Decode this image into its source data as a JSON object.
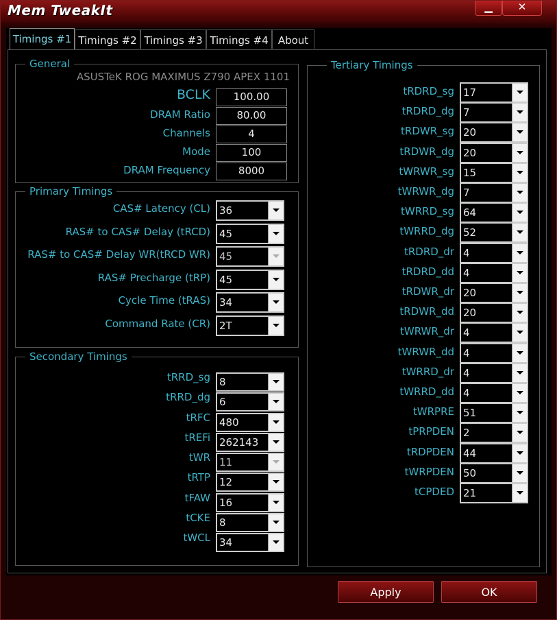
{
  "window": {
    "title": "Mem TweakIt",
    "minimize_glyph": "▁",
    "close_glyph": "✕"
  },
  "tabs": [
    {
      "label": "Timings #1",
      "active": true
    },
    {
      "label": "Timings #2",
      "active": false
    },
    {
      "label": "Timings #3",
      "active": false
    },
    {
      "label": "Timings #4",
      "active": false
    },
    {
      "label": "About",
      "active": false
    }
  ],
  "general": {
    "title": "General",
    "board": "ASUSTeK ROG MAXIMUS Z790 APEX 1101",
    "fields": [
      {
        "label": "BCLK",
        "value": "100.00"
      },
      {
        "label": "DRAM Ratio",
        "value": "80.00"
      },
      {
        "label": "Channels",
        "value": "4"
      },
      {
        "label": "Mode",
        "value": "100"
      },
      {
        "label": "DRAM Frequency",
        "value": "8000"
      }
    ]
  },
  "primary": {
    "title": "Primary Timings",
    "rows": [
      {
        "label": "CAS# Latency (CL)",
        "value": "36",
        "enabled": true
      },
      {
        "label": "RAS# to CAS# Delay (tRCD)",
        "value": "45",
        "enabled": true
      },
      {
        "label": "RAS# to CAS# Delay WR(tRCD WR)",
        "value": "45",
        "enabled": false
      },
      {
        "label": "RAS# Precharge (tRP)",
        "value": "45",
        "enabled": true
      },
      {
        "label": "Cycle Time (tRAS)",
        "value": "34",
        "enabled": true
      },
      {
        "label": "Command Rate (CR)",
        "value": "2T",
        "enabled": true
      }
    ]
  },
  "secondary": {
    "title": "Secondary Timings",
    "rows": [
      {
        "label": "tRRD_sg",
        "value": "8",
        "enabled": true
      },
      {
        "label": "tRRD_dg",
        "value": "6",
        "enabled": true
      },
      {
        "label": "tRFC",
        "value": "480",
        "enabled": true
      },
      {
        "label": "tREFi",
        "value": "262143",
        "enabled": true
      },
      {
        "label": "tWR",
        "value": "11",
        "enabled": false
      },
      {
        "label": "tRTP",
        "value": "12",
        "enabled": true
      },
      {
        "label": "tFAW",
        "value": "16",
        "enabled": true
      },
      {
        "label": "tCKE",
        "value": "8",
        "enabled": true
      },
      {
        "label": "tWCL",
        "value": "34",
        "enabled": true
      }
    ]
  },
  "tertiary": {
    "title": "Tertiary Timings",
    "rows": [
      {
        "label": "tRDRD_sg",
        "value": "17"
      },
      {
        "label": "tRDRD_dg",
        "value": "7"
      },
      {
        "label": "tRDWR_sg",
        "value": "20"
      },
      {
        "label": "tRDWR_dg",
        "value": "20"
      },
      {
        "label": "tWRWR_sg",
        "value": "15"
      },
      {
        "label": "tWRWR_dg",
        "value": "7"
      },
      {
        "label": "tWRRD_sg",
        "value": "64"
      },
      {
        "label": "tWRRD_dg",
        "value": "52"
      },
      {
        "label": "tRDRD_dr",
        "value": "4"
      },
      {
        "label": "tRDRD_dd",
        "value": "4"
      },
      {
        "label": "tRDWR_dr",
        "value": "20"
      },
      {
        "label": "tRDWR_dd",
        "value": "20"
      },
      {
        "label": "tWRWR_dr",
        "value": "4"
      },
      {
        "label": "tWRWR_dd",
        "value": "4"
      },
      {
        "label": "tWRRD_dr",
        "value": "4"
      },
      {
        "label": "tWRRD_dd",
        "value": "4"
      },
      {
        "label": "tWRPRE",
        "value": "51"
      },
      {
        "label": "tPRPDEN",
        "value": "2"
      },
      {
        "label": "tRDPDEN",
        "value": "44"
      },
      {
        "label": "tWRPDEN",
        "value": "50"
      },
      {
        "label": "tCPDED",
        "value": "21"
      }
    ]
  },
  "actions": {
    "apply": "Apply",
    "ok": "OK"
  },
  "colors": {
    "label_cyan": "#3fb3c8",
    "window_red": "#5a0808",
    "text_white": "#e8e8e8"
  }
}
